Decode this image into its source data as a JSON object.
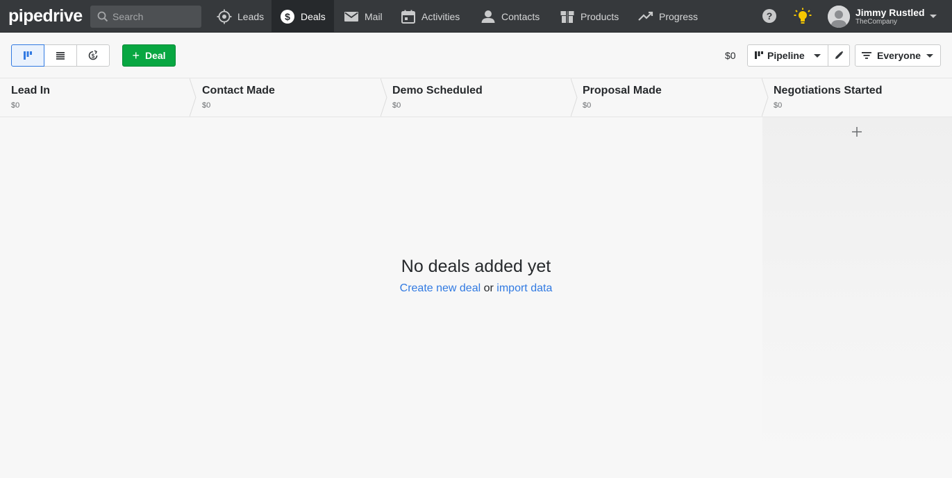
{
  "app": {
    "logo": "pipedrive"
  },
  "search": {
    "placeholder": "Search"
  },
  "nav": [
    {
      "label": "Leads",
      "icon": "target-icon"
    },
    {
      "label": "Deals",
      "icon": "dollar-circle-icon",
      "active": true
    },
    {
      "label": "Mail",
      "icon": "envelope-icon"
    },
    {
      "label": "Activities",
      "icon": "calendar-icon"
    },
    {
      "label": "Contacts",
      "icon": "person-icon"
    },
    {
      "label": "Products",
      "icon": "box-icon"
    },
    {
      "label": "Progress",
      "icon": "trend-up-icon"
    }
  ],
  "user": {
    "name": "Jimmy Rustled",
    "company": "TheCompany"
  },
  "toolbar": {
    "views": [
      "kanban-view-icon",
      "list-view-icon",
      "forecast-view-icon"
    ],
    "add_deal_label": "Deal",
    "total": "$0",
    "pipeline_label": "Pipeline",
    "filter_label": "Everyone"
  },
  "stages": [
    {
      "name": "Lead In",
      "value": "$0"
    },
    {
      "name": "Contact Made",
      "value": "$0"
    },
    {
      "name": "Demo Scheduled",
      "value": "$0"
    },
    {
      "name": "Proposal Made",
      "value": "$0"
    },
    {
      "name": "Negotiations Started",
      "value": "$0"
    }
  ],
  "empty": {
    "title": "No deals added yet",
    "create_link": "Create new deal",
    "or_text": "or",
    "import_link": "import data"
  },
  "colors": {
    "topbar": "#36393c",
    "accent": "#317ae2",
    "primary_button": "#08a742",
    "bulb": "#f6c700"
  }
}
